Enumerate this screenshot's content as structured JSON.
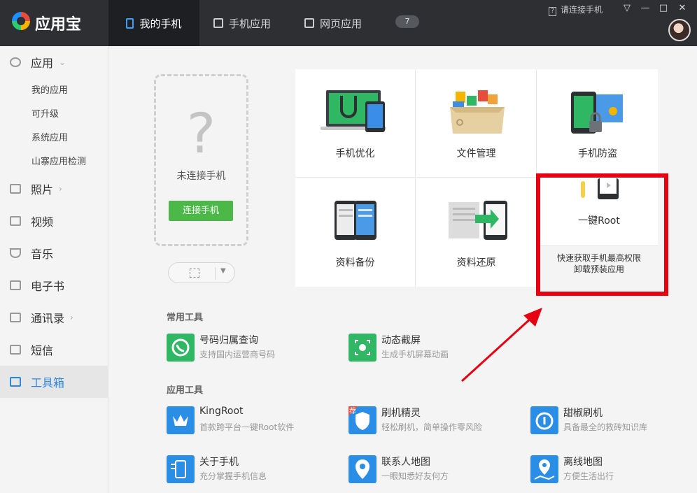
{
  "app": {
    "name": "应用宝"
  },
  "topnav": {
    "my_phone": "我的手机",
    "phone_apps": "手机应用",
    "web_apps": "网页应用",
    "msg_count": "7"
  },
  "window": {
    "connect_hint": "请连接手机",
    "minimize": "—",
    "maximize": "□",
    "close": "✕"
  },
  "sidebar": {
    "apps": "应用",
    "app_sub": [
      "我的应用",
      "可升级",
      "系统应用",
      "山寨应用检测"
    ],
    "photos": "照片",
    "video": "视频",
    "music": "音乐",
    "ebook": "电子书",
    "contacts": "通讯录",
    "sms": "短信",
    "toolbox": "工具箱",
    "chevron": "›",
    "down_chevron": "⌄"
  },
  "phone_panel": {
    "placeholder": "?",
    "status": "未连接手机",
    "connect_btn": "连接手机"
  },
  "tools": {
    "optimize": "手机优化",
    "files": "文件管理",
    "antitheft": "手机防盗",
    "backup": "资料备份",
    "restore": "资料还原",
    "root": "一键Root",
    "root_desc_1": "快速获取手机最高权限",
    "root_desc_2": "卸载预装应用"
  },
  "common_tools": {
    "title": "常用工具",
    "items": [
      {
        "name": "号码归属查询",
        "desc": "支持国内运营商号码",
        "icon": "phone-call-icon",
        "color": "#2fb764"
      },
      {
        "name": "动态截屏",
        "desc": "生成手机屏幕动画",
        "icon": "screen-record-icon",
        "color": "#2fb764"
      }
    ]
  },
  "app_tools": {
    "title": "应用工具",
    "items": [
      {
        "name": "KingRoot",
        "desc": "首款跨平台一键Root软件",
        "icon": "crown-icon",
        "color": "#2a8ee6"
      },
      {
        "name": "刷机精灵",
        "desc": "轻松刷机，简单操作零风险",
        "icon": "flash-shield-icon",
        "color": "#2a8ee6",
        "badge": "荐"
      },
      {
        "name": "甜椒刷机",
        "desc": "具备最全的救砖知识库",
        "icon": "pepper-icon",
        "color": "#2a8ee6"
      },
      {
        "name": "关于手机",
        "desc": "充分掌握手机信息",
        "icon": "phone-info-icon",
        "color": "#2a8ee6"
      },
      {
        "name": "联系人地图",
        "desc": "一眼知悉好友何方",
        "icon": "contact-pin-icon",
        "color": "#2a8ee6"
      },
      {
        "name": "离线地图",
        "desc": "方便生活出行",
        "icon": "map-pin-icon",
        "color": "#2a8ee6"
      }
    ]
  },
  "colors": {
    "accent": "#2c86e0",
    "connect_green": "#4cb848",
    "highlight_red": "#e60012"
  }
}
